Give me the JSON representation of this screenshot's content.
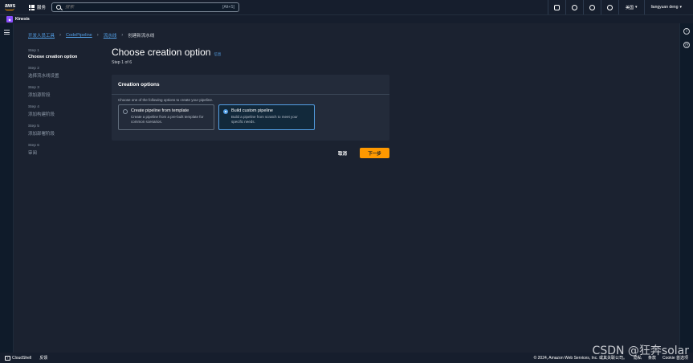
{
  "topbar": {
    "logo": "aws",
    "services_label": "服务",
    "search_placeholder": "搜索",
    "search_shortcut": "[Alt+S]",
    "region": "美国",
    "user": "liangyuan deng"
  },
  "favorites": {
    "kinesis": "Kinesis"
  },
  "breadcrumb": {
    "items": [
      "开发人员工具",
      "CodePipeline",
      "流水线"
    ],
    "current": "创建新流水线"
  },
  "steps": [
    {
      "num": "Step 1",
      "title": "Choose creation option"
    },
    {
      "num": "Step 2",
      "title": "选择流水线设置"
    },
    {
      "num": "Step 3",
      "title": "添加源阶段"
    },
    {
      "num": "Step 4",
      "title": "添加构建阶段"
    },
    {
      "num": "Step 5",
      "title": "添加部署阶段"
    },
    {
      "num": "Step 6",
      "title": "审阅"
    }
  ],
  "page": {
    "title": "Choose creation option",
    "info": "信息",
    "subtitle": "Step 1 of 6"
  },
  "creation_options": {
    "header": "Creation options",
    "description": "Choose one of the following options to create your pipeline.",
    "tiles": [
      {
        "title": "Create pipeline from template",
        "desc": "Create a pipeline from a pre-built template for common scenarios.",
        "selected": false
      },
      {
        "title": "Build custom pipeline",
        "desc": "Build a pipeline from scratch to meet your specific needs.",
        "selected": true
      }
    ]
  },
  "actions": {
    "cancel": "取消",
    "next": "下一步"
  },
  "footer": {
    "cloudshell": "CloudShell",
    "feedback": "反馈",
    "copyright": "© 2024, Amazon Web Services, Inc. 或其关联公司。",
    "privacy": "隐私",
    "terms": "条款",
    "cookie": "Cookie 首选项"
  },
  "watermark": "CSDN @狂奔solar"
}
